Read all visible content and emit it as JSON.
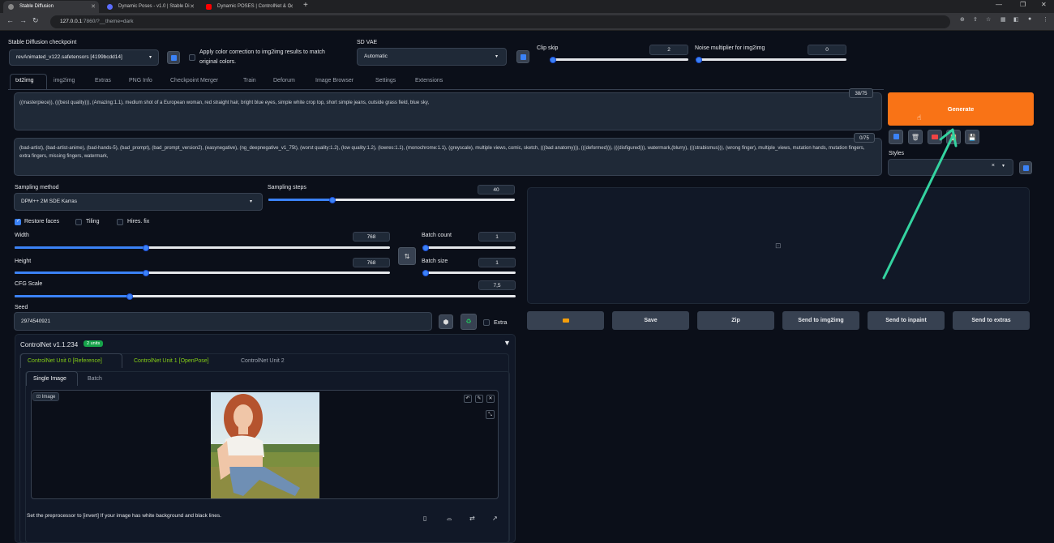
{
  "browser": {
    "tabs": [
      {
        "title": "Stable Diffusion",
        "active": true
      },
      {
        "title": "Dynamic Poses - v1.0 | Stable Di"
      },
      {
        "title": "Dynamic POSES | ControlNet & C"
      }
    ],
    "new_tab": "+",
    "url_host": "127.0.0.1",
    "url_path": ":7860/?__theme=dark"
  },
  "top": {
    "checkpoint_label": "Stable Diffusion checkpoint",
    "checkpoint_value": "revAnimated_v122.safetensors [4199bcdd14]",
    "color_correction_label": "Apply color correction to img2img results to match original colors.",
    "vae_label": "SD VAE",
    "vae_value": "Automatic",
    "clip_skip_label": "Clip skip",
    "clip_skip_value": "2",
    "clip_skip_fraction": 0.0,
    "noise_label": "Noise multiplier for img2img",
    "noise_value": "0",
    "noise_fraction": 0.0
  },
  "tabs": [
    "txt2img",
    "img2img",
    "Extras",
    "PNG Info",
    "Checkpoint Merger",
    "Train",
    "Deforum",
    "Image Browser",
    "Settings",
    "Extensions"
  ],
  "prompt": {
    "positive": "((masterpiece)), (((best quality))), (Amazing:1.1), medium shot of a European woman, red straight hair, bright blue eyes, simple white crop top, short simple jeans, outside grass field, blue sky,",
    "positive_count": "38/75",
    "negative": "(bad-artist), (bad-artist-anime), (bad-hands-5), (bad_prompt), (bad_prompt_version2), (easynegative), (ng_deepnegative_v1_75t), (worst quality:1.2), (low quality:1.2), (lowres:1.1), (monochrome:1.1), (greyscale), multiple views, comic, sketch, (((bad anatomy))), (((deformed))), (((disfigured))), watermark,(blurry), (((strabismus))), (wrong finger), multiple_views, mutation hands, mutation fingers, extra fingers, missing fingers, watermark,",
    "negative_count": "0/75"
  },
  "generate_label": "Generate",
  "styles_label": "Styles",
  "styles_clear": "×",
  "sampling": {
    "method_label": "Sampling method",
    "method_value": "DPM++ 2M SDE Karras",
    "steps_label": "Sampling steps",
    "steps_value": "40",
    "steps_fraction": 0.26
  },
  "checks": {
    "restore_faces": "Restore faces",
    "tiling": "Tiling",
    "hires": "Hires. fix"
  },
  "size": {
    "width_label": "Width",
    "width_value": "768",
    "width_fraction": 0.35,
    "height_label": "Height",
    "height_value": "768",
    "height_fraction": 0.35,
    "batch_count_label": "Batch count",
    "batch_count_value": "1",
    "batch_size_label": "Batch size",
    "batch_size_value": "1",
    "cfg_label": "CFG Scale",
    "cfg_value": "7,5",
    "cfg_fraction": 0.23
  },
  "seed": {
    "label": "Seed",
    "value": "2974540921",
    "extra_label": "Extra"
  },
  "output_buttons": [
    "Save",
    "Zip",
    "Send to img2img",
    "Send to inpaint",
    "Send to extras"
  ],
  "controlnet": {
    "title": "ControlNet v1.1.234",
    "badge": "2 units",
    "unit_tabs": [
      "ControlNet Unit 0 [Reference]",
      "ControlNet Unit 1 [OpenPose]",
      "ControlNet Unit 2"
    ],
    "image_tabs": [
      "Single Image",
      "Batch"
    ],
    "image_label": "Image",
    "hint": "Set the preprocessor to [invert] If your image has white background and black lines."
  },
  "colors": {
    "generate": "#f97316",
    "accent": "#3b82f6",
    "arrow": "#34d3a0",
    "unit_active": "#84cc16"
  }
}
